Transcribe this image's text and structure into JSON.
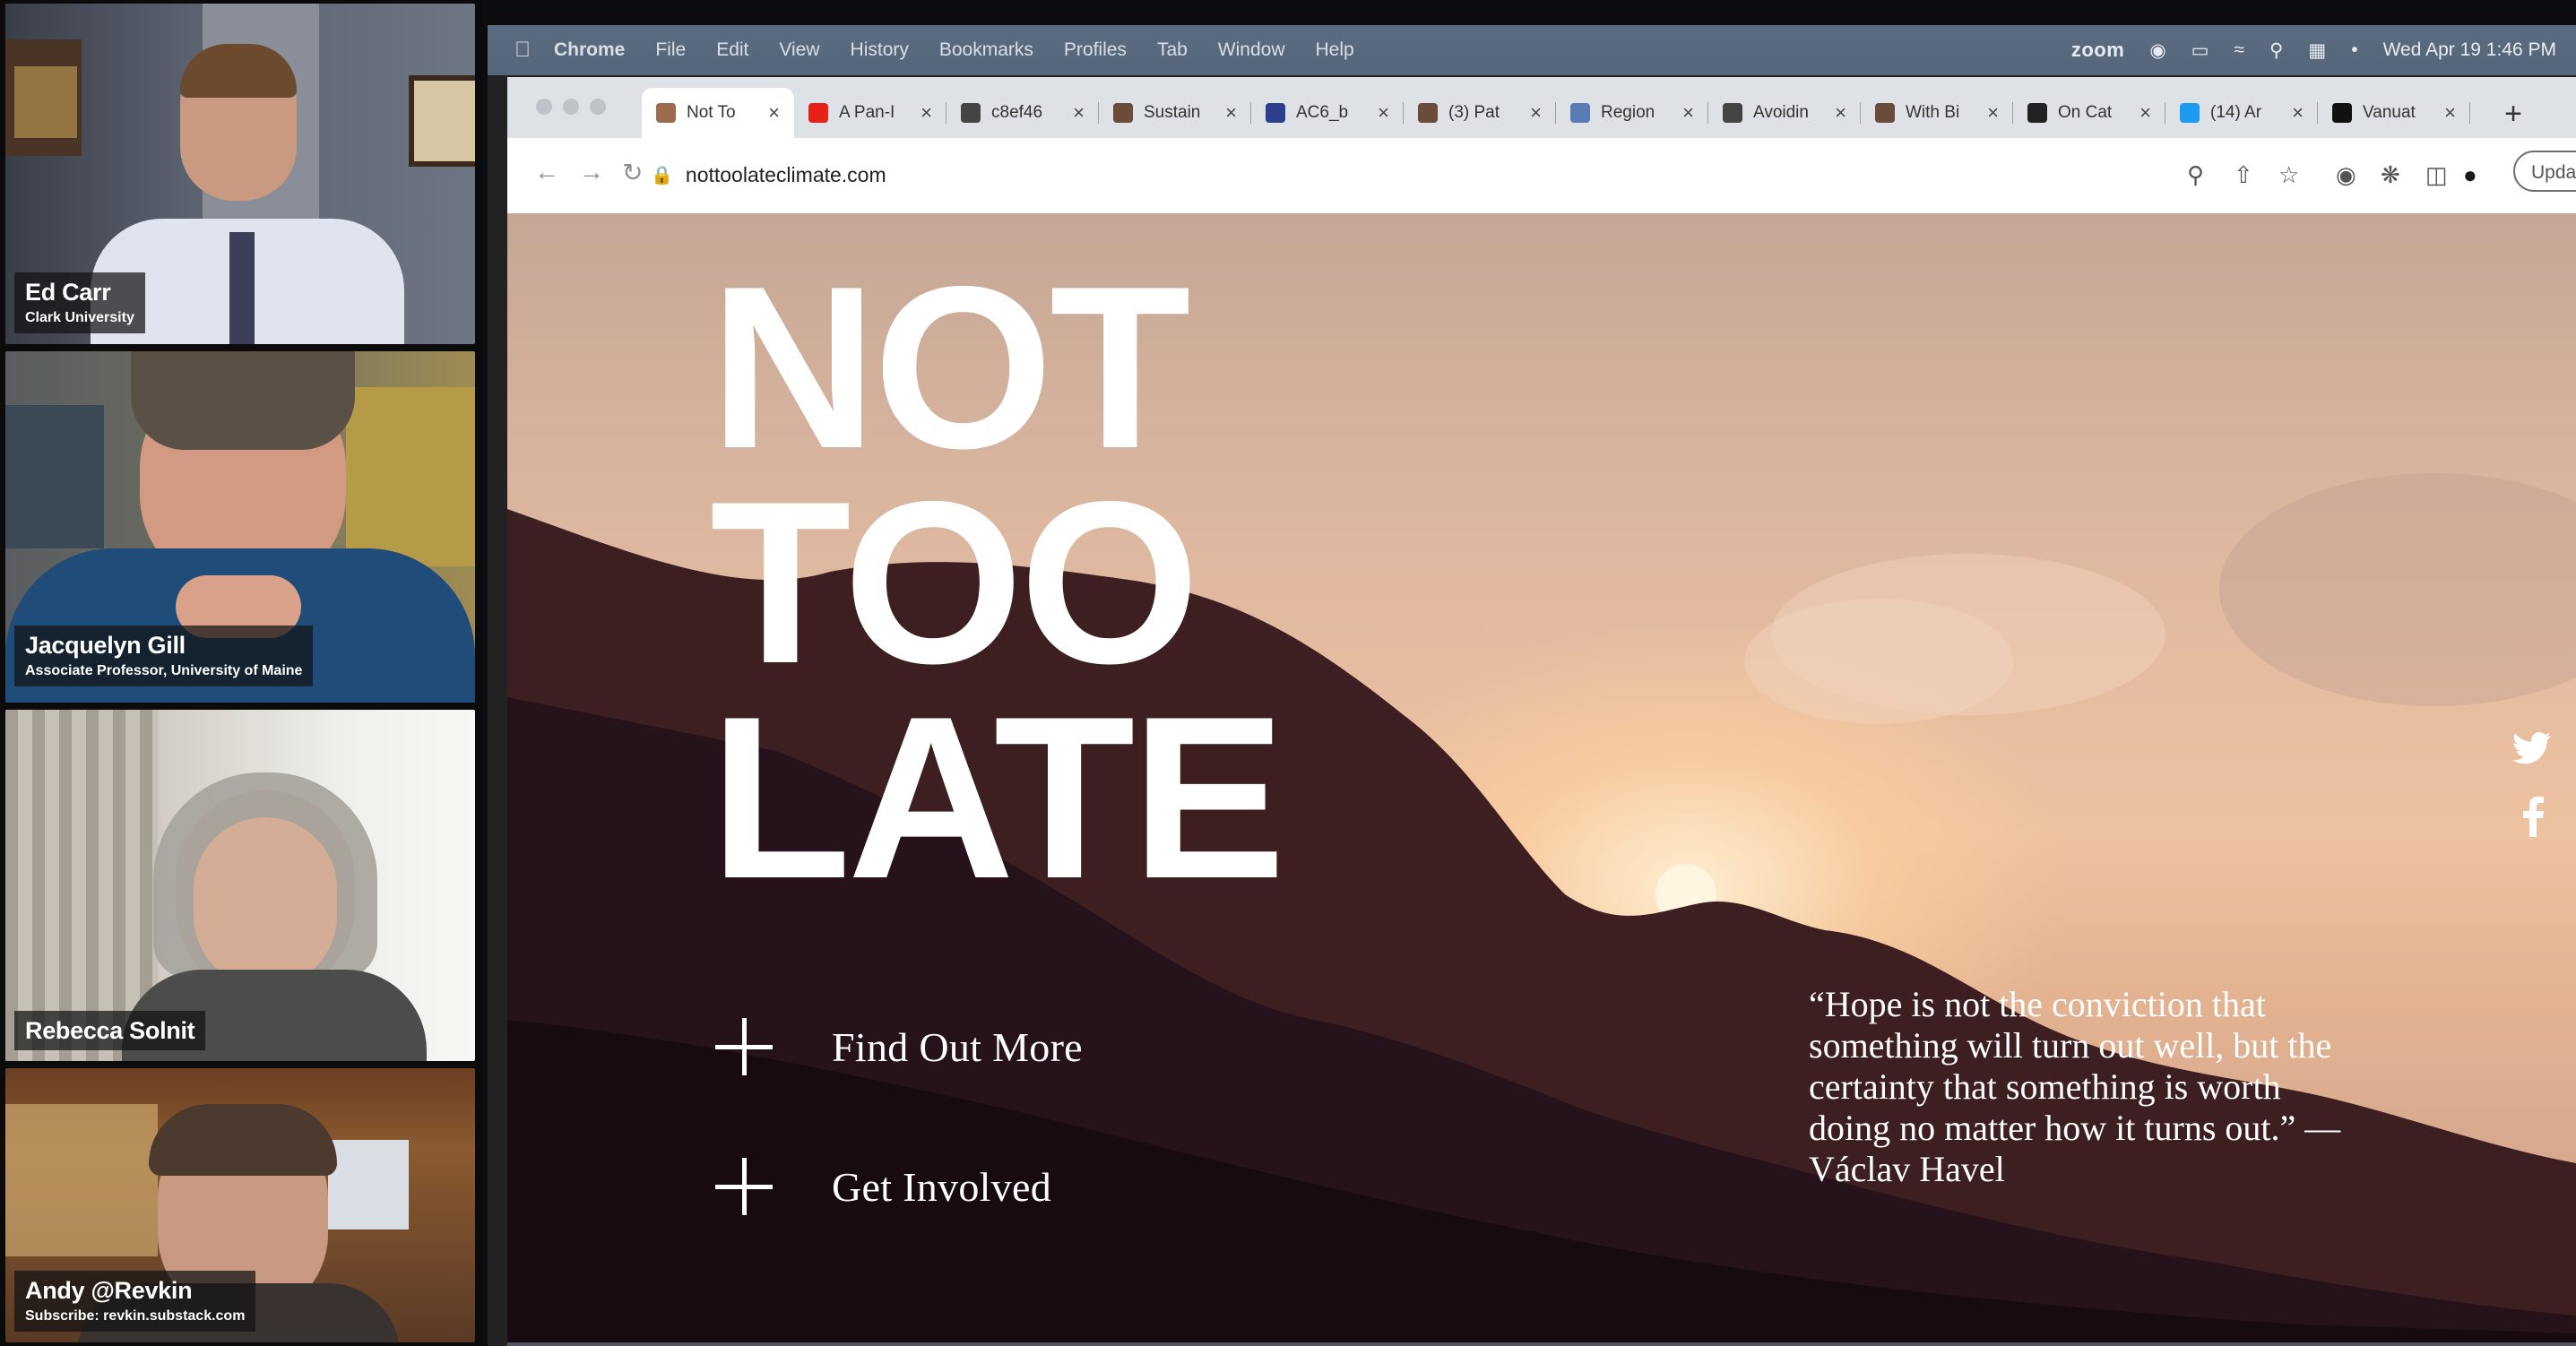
{
  "participants": [
    {
      "name": "Ed Carr",
      "affiliation": "Clark University"
    },
    {
      "name": "Jacquelyn Gill",
      "affiliation": "Associate Professor, University of Maine"
    },
    {
      "name": "Rebecca Solnit",
      "affiliation": ""
    },
    {
      "name": "Andy @Revkin",
      "affiliation": "Subscribe: revkin.substack.com"
    }
  ],
  "menubar": {
    "app": "Chrome",
    "items": [
      "File",
      "Edit",
      "View",
      "History",
      "Bookmarks",
      "Profiles",
      "Tab",
      "Window",
      "Help"
    ],
    "zoom_label": "zoom",
    "clock": "Wed Apr 19  1:46 PM"
  },
  "browser": {
    "tabs": [
      {
        "title": "Not To",
        "favicon_color": "#9a6b4d",
        "active": true
      },
      {
        "title": "A Pan-I",
        "favicon_color": "#e62117"
      },
      {
        "title": "c8ef46",
        "favicon_color": "#444444"
      },
      {
        "title": "Sustain",
        "favicon_color": "#6b4c3a"
      },
      {
        "title": "AC6_b",
        "favicon_color": "#2c3e8c"
      },
      {
        "title": "(3) Pat",
        "favicon_color": "#6b4c3a"
      },
      {
        "title": "Region",
        "favicon_color": "#5b7bb5"
      },
      {
        "title": "Avoidin",
        "favicon_color": "#444444"
      },
      {
        "title": "With Bi",
        "favicon_color": "#6b4c3a"
      },
      {
        "title": "On Cat",
        "favicon_color": "#222222"
      },
      {
        "title": "(14) Ar",
        "favicon_color": "#1d9bf0"
      },
      {
        "title": "Vanuat",
        "favicon_color": "#111111"
      }
    ],
    "url": "nottoolateclimate.com",
    "update_label": "Updat"
  },
  "site": {
    "hero": [
      "NOT",
      "TOO",
      "LATE"
    ],
    "cta_find": "Find Out More",
    "cta_involved": "Get Involved",
    "quote": "“Hope is not the conviction that something will turn out well, but the certainty that something is worth doing no matter how it turns out.”  — Václav Havel"
  },
  "colors": {
    "menubar": "#56667a",
    "chrome_tabstrip": "#dee1e6",
    "sky_warm": "#edc2a0",
    "mountain_dark": "#2a1418"
  }
}
